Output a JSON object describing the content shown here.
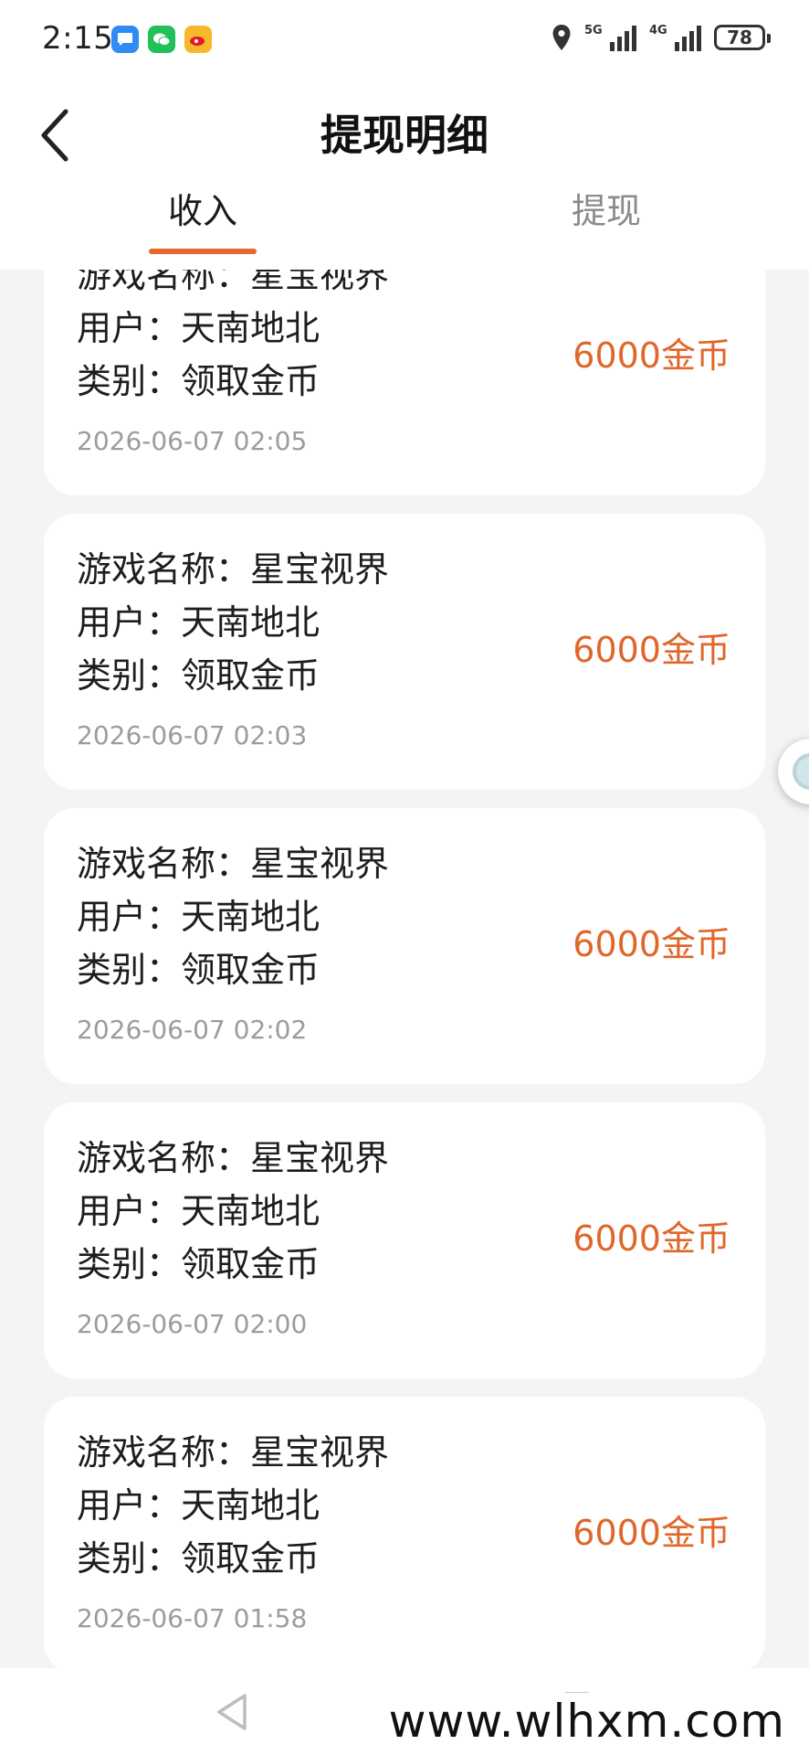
{
  "status_bar": {
    "time": "2:15",
    "network_5g": "5G",
    "network_4g": "4G",
    "battery": "78"
  },
  "header": {
    "title": "提现明细",
    "tabs": [
      {
        "label": "收入",
        "active": true
      },
      {
        "label": "提现",
        "active": false
      }
    ]
  },
  "records": [
    {
      "game_line": "游戏名称：星宝视界",
      "user_line": "用户：天南地北",
      "type_line": "类别：领取金币",
      "amount": "6000金币",
      "time": "2026-06-07 02:05"
    },
    {
      "game_line": "游戏名称：星宝视界",
      "user_line": "用户：天南地北",
      "type_line": "类别：领取金币",
      "amount": "6000金币",
      "time": "2026-06-07 02:03"
    },
    {
      "game_line": "游戏名称：星宝视界",
      "user_line": "用户：天南地北",
      "type_line": "类别：领取金币",
      "amount": "6000金币",
      "time": "2026-06-07 02:02"
    },
    {
      "game_line": "游戏名称：星宝视界",
      "user_line": "用户：天南地北",
      "type_line": "类别：领取金币",
      "amount": "6000金币",
      "time": "2026-06-07 02:00"
    },
    {
      "game_line": "游戏名称：星宝视界",
      "user_line": "用户：天南地北",
      "type_line": "类别：领取金币",
      "amount": "6000金币",
      "time": "2026-06-07 01:58"
    }
  ],
  "watermark": "www.wlhxm.com",
  "colors": {
    "accent": "#e8672a",
    "amount": "#e0662a",
    "background": "#f4f4f5"
  }
}
